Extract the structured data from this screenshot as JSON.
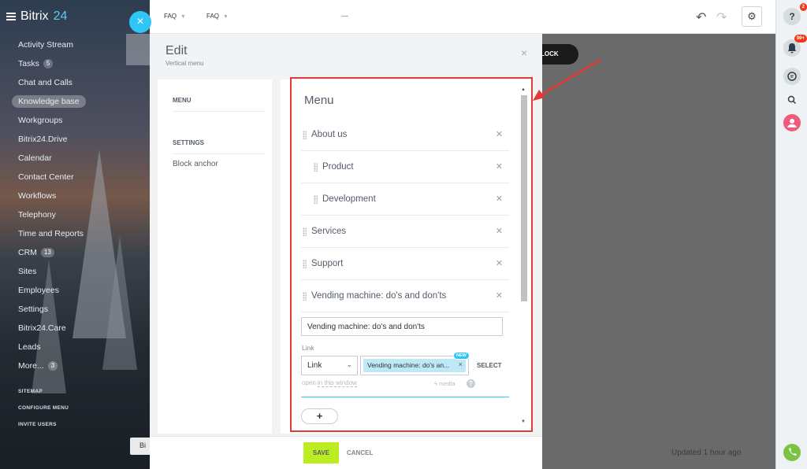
{
  "sidebar": {
    "logo_part1": "Bitrix",
    "logo_part2": "24",
    "items": [
      {
        "label": "Activity Stream",
        "count": ""
      },
      {
        "label": "Tasks",
        "count": "5"
      },
      {
        "label": "Chat and Calls",
        "count": ""
      },
      {
        "label": "Knowledge base",
        "count": ""
      },
      {
        "label": "Workgroups",
        "count": ""
      },
      {
        "label": "Bitrix24.Drive",
        "count": ""
      },
      {
        "label": "Calendar",
        "count": ""
      },
      {
        "label": "Contact Center",
        "count": ""
      },
      {
        "label": "Workflows",
        "count": ""
      },
      {
        "label": "Telephony",
        "count": ""
      },
      {
        "label": "Time and Reports",
        "count": ""
      },
      {
        "label": "CRM",
        "count": "13"
      },
      {
        "label": "Sites",
        "count": ""
      },
      {
        "label": "Employees",
        "count": ""
      },
      {
        "label": "Settings",
        "count": ""
      },
      {
        "label": "Bitrix24.Care",
        "count": ""
      },
      {
        "label": "Leads",
        "count": ""
      },
      {
        "label": "More...",
        "count": "3"
      }
    ],
    "footer_links": [
      "SITEMAP",
      "CONFIGURE MENU",
      "INVITE USERS"
    ],
    "close_glyph": "×"
  },
  "topbar": {
    "crumb1": "FAQ",
    "crumb2": "FAQ",
    "undo_glyph": "↶",
    "redo_glyph": "↷",
    "gear_glyph": "⚙",
    "add_block_label": "LOCK"
  },
  "background": {
    "updated_text": "Updated 1 hour ago",
    "bottom_btn_label": "Bi"
  },
  "rightbar": {
    "help_badge": "2",
    "bell_badge": "99+"
  },
  "dialog": {
    "title": "Edit",
    "subtitle": "Vertical menu",
    "close_glyph": "×",
    "left_sections": {
      "menu": "MENU",
      "settings": "SETTINGS",
      "block_anchor": "Block anchor"
    },
    "menu_heading": "Menu",
    "menu_items": [
      {
        "label": "About us",
        "level": 0
      },
      {
        "label": "Product",
        "level": 1
      },
      {
        "label": "Development",
        "level": 1
      },
      {
        "label": "Services",
        "level": 0
      },
      {
        "label": "Support",
        "level": 0
      },
      {
        "label": "Vending machine: do's and don'ts",
        "level": 0
      }
    ],
    "editor": {
      "title_value": "Vending machine: do's and don'ts",
      "link_label": "Link",
      "link_type": "Link",
      "link_target": "Vending machine: do's an...",
      "new_tag": "NEW",
      "select_label": "SELECT",
      "open_in_prefix": "open",
      "open_in_link": "in this window",
      "media_label": "media",
      "add_label": "+"
    },
    "footer": {
      "save": "SAVE",
      "cancel": "CANCEL"
    }
  },
  "colors": {
    "accent": "#2fc6f6",
    "save": "#bbed21",
    "annotation": "#e53935"
  }
}
